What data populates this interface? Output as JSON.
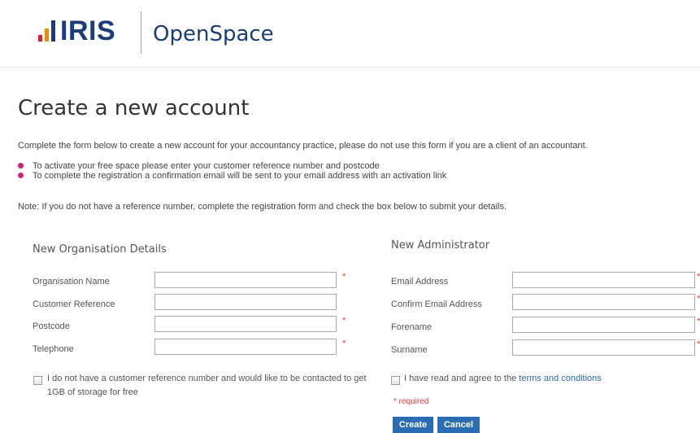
{
  "header": {
    "logo_text": "IRIS",
    "product_name": "OpenSpace"
  },
  "page": {
    "title": "Create a new account",
    "intro": "Complete the form below to create a new account for your accountancy practice, please do not use this form if you are a client of an accountant.",
    "bullets": [
      "To activate your free space please enter your customer reference number and postcode",
      "To complete the registration a confirmation email will be sent to your email address with an activation link"
    ],
    "note": "Note: If you do not have a reference number, complete the registration form and check the box below to submit your details."
  },
  "organisation": {
    "title": "New Organisation Details",
    "fields": [
      {
        "label": "Organisation Name",
        "value": "",
        "required": "*"
      },
      {
        "label": "Customer Reference",
        "value": ""
      },
      {
        "label": "Postcode",
        "value": "",
        "required": "*"
      },
      {
        "label": "Telephone",
        "value": "",
        "required": "*"
      }
    ],
    "no_reference_checkbox": "I do not have a customer reference number and would like to be contacted to get 1GB of storage for free"
  },
  "administrator": {
    "title": "New Administrator",
    "fields": [
      {
        "label": "Email Address",
        "value": "",
        "required": "*"
      },
      {
        "label": "Confirm Email Address",
        "value": "",
        "required": "*"
      },
      {
        "label": "Forename",
        "value": "",
        "required": "*"
      },
      {
        "label": "Surname",
        "value": "",
        "required": "*"
      }
    ],
    "terms_prefix": "I have read and agree to the",
    "terms_link": "terms and conditions"
  },
  "required_note": "* required",
  "buttons": {
    "create": "Create",
    "cancel": "Cancel"
  },
  "colors": {
    "brand_navy": "#1b3c78",
    "bullet_magenta": "#d0227a",
    "required_red": "#e03c3c",
    "button_blue": "#2a6db5",
    "link_blue": "#2a6aa8"
  }
}
